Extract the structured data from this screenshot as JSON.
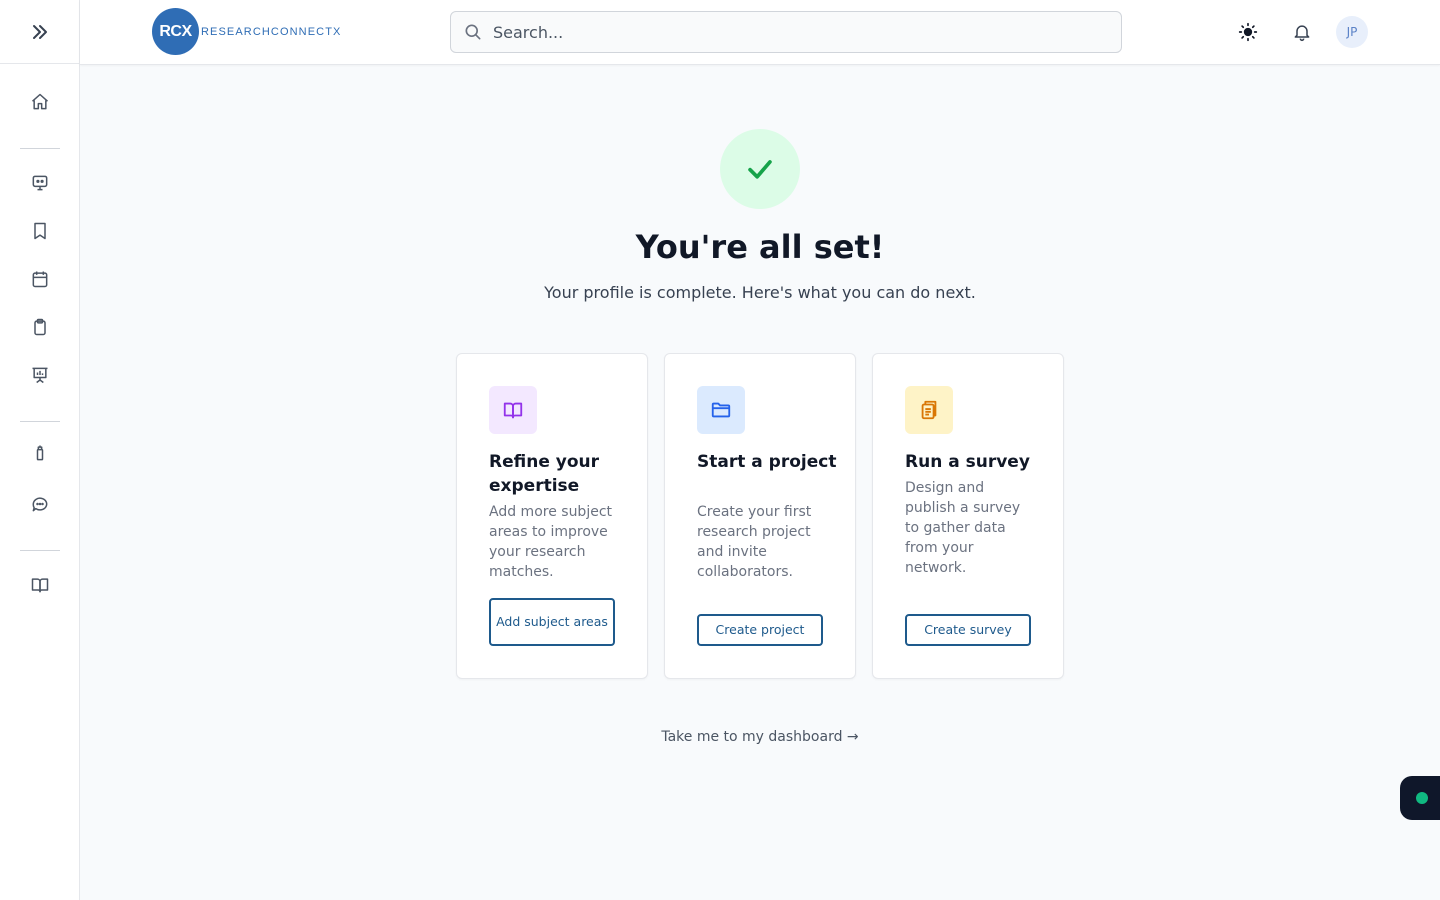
{
  "header": {
    "logo_mark": "RCX",
    "logo_text": "RESEARCHCONNECTX",
    "search_placeholder": "Search...",
    "avatar_initials": "JP"
  },
  "main": {
    "title": "You're all set!",
    "subtitle": "Your profile is complete. Here's what you can do next.",
    "cards": [
      {
        "title": "Refine your expertise",
        "description": "Add more subject areas to improve your research matches.",
        "button": "Add subject areas",
        "icon": "book-open-icon",
        "icon_bg": "#f3e8ff",
        "icon_color": "#9333ea"
      },
      {
        "title": "Start a project",
        "description": "Create your first research project and invite collaborators.",
        "button": "Create project",
        "icon": "folder-icon",
        "icon_bg": "#dbeafe",
        "icon_color": "#2563eb"
      },
      {
        "title": "Run a survey",
        "description": "Design and publish a survey to gather data from your network.",
        "button": "Create survey",
        "icon": "clipboard-list-icon",
        "icon_bg": "#fef3c7",
        "icon_color": "#d97706"
      }
    ],
    "dashboard_link": "Take me to my dashboard →"
  },
  "colors": {
    "brand": "#2f6db5",
    "button_border": "#1e5a8c",
    "success_bg": "#dcfce7",
    "success_check": "#16a34a",
    "status_dot": "#10b981"
  }
}
